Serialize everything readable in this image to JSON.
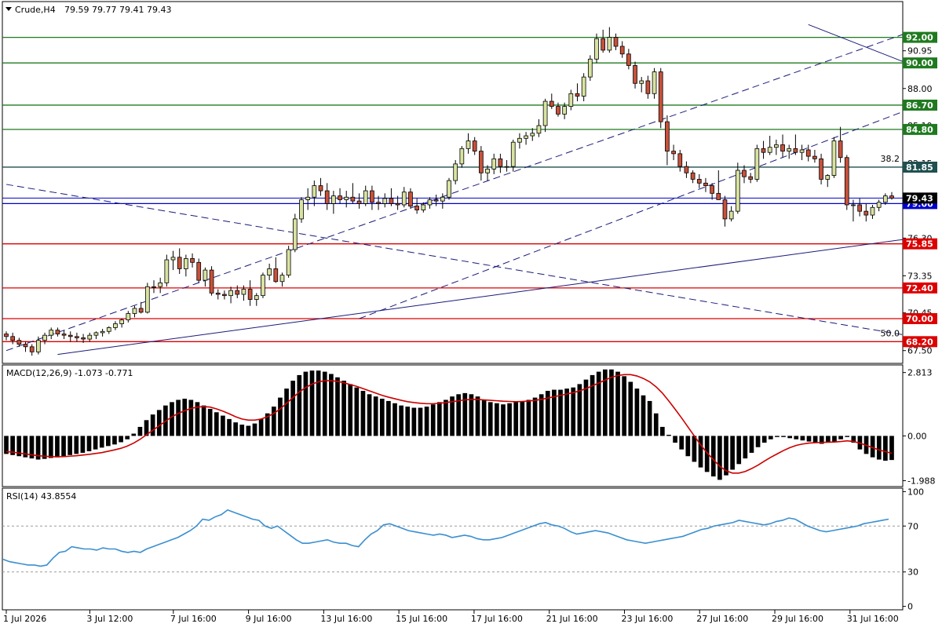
{
  "chart_data": {
    "type": "candlestick",
    "symbol_header": {
      "symbol": "Crude,H4",
      "values": "79.59 79.77 79.41 79.43"
    },
    "price_axis": {
      "range": [
        66.5,
        94.8
      ],
      "ticks": [
        "90.95",
        "88.00",
        "85.10",
        "82.15",
        "79.43",
        "76.30",
        "73.35",
        "70.45",
        "67.50"
      ]
    },
    "horizontal_levels": [
      {
        "value": 92.0,
        "label": "92.00",
        "color": "#1f7a1f"
      },
      {
        "value": 90.0,
        "label": "90.00",
        "color": "#1f7a1f"
      },
      {
        "value": 86.7,
        "label": "86.70",
        "color": "#1f7a1f"
      },
      {
        "value": 84.8,
        "label": "84.80",
        "color": "#1f7a1f"
      },
      {
        "value": 81.85,
        "label": "81.85",
        "color": "#1f4f4f"
      },
      {
        "value": 79.0,
        "label": "79.00",
        "color": "#0000cc"
      },
      {
        "value": 75.85,
        "label": "75.85",
        "color": "#dd0000"
      },
      {
        "value": 72.4,
        "label": "72.40",
        "color": "#dd0000"
      },
      {
        "value": 70.0,
        "label": "70.00",
        "color": "#dd0000"
      },
      {
        "value": 68.2,
        "label": "68.20",
        "color": "#dd0000"
      }
    ],
    "current_price": {
      "value": 79.43,
      "label": "79.43"
    },
    "last_close_line": {
      "value": 79.43,
      "color": "#0000cc"
    },
    "fib_labels": [
      {
        "text": "38.2",
        "value": 82.15
      },
      {
        "text": "50.0",
        "value": 68.5
      }
    ],
    "trend_lines": [
      {
        "style": "dashed",
        "from": [
          0,
          67.5
        ],
        "to": [
          178,
          99.0
        ]
      },
      {
        "style": "dashed",
        "from": [
          55,
          70.0
        ],
        "to": [
          178,
          93.5
        ]
      },
      {
        "style": "dashed",
        "from": [
          0,
          80.5
        ],
        "to": [
          164,
          66.7
        ]
      },
      {
        "style": "solid",
        "from": [
          8,
          67.2
        ],
        "to": [
          178,
          78.8
        ]
      },
      {
        "style": "solid",
        "from": [
          125,
          93.0
        ],
        "to": [
          178,
          82.6
        ]
      }
    ],
    "candles": [
      [
        68.8,
        69.0,
        68.3,
        68.6
      ],
      [
        68.6,
        68.9,
        68.0,
        68.3
      ],
      [
        68.3,
        68.5,
        67.8,
        68.0
      ],
      [
        68.0,
        68.2,
        67.4,
        67.8
      ],
      [
        67.8,
        68.0,
        67.1,
        67.4
      ],
      [
        67.4,
        68.6,
        67.2,
        68.3
      ],
      [
        68.3,
        68.9,
        68.0,
        68.7
      ],
      [
        68.7,
        69.3,
        68.4,
        69.1
      ],
      [
        69.1,
        69.3,
        68.6,
        68.8
      ],
      [
        68.8,
        69.1,
        68.4,
        68.7
      ],
      [
        68.7,
        69.0,
        68.2,
        68.6
      ],
      [
        68.6,
        68.9,
        68.2,
        68.5
      ],
      [
        68.5,
        68.8,
        68.1,
        68.4
      ],
      [
        68.4,
        68.9,
        68.2,
        68.7
      ],
      [
        68.7,
        69.0,
        68.4,
        68.9
      ],
      [
        68.9,
        69.2,
        68.6,
        69.0
      ],
      [
        69.0,
        69.4,
        68.8,
        69.3
      ],
      [
        69.3,
        69.8,
        69.1,
        69.6
      ],
      [
        69.6,
        70.0,
        69.3,
        69.9
      ],
      [
        69.9,
        70.6,
        69.7,
        70.4
      ],
      [
        70.4,
        71.0,
        70.1,
        70.8
      ],
      [
        70.8,
        71.3,
        70.4,
        70.5
      ],
      [
        70.5,
        72.8,
        70.4,
        72.5
      ],
      [
        72.5,
        73.0,
        72.0,
        72.5
      ],
      [
        72.5,
        73.2,
        72.0,
        72.8
      ],
      [
        72.8,
        75.0,
        72.5,
        74.6
      ],
      [
        74.6,
        75.3,
        73.8,
        74.8
      ],
      [
        74.8,
        75.5,
        73.5,
        73.9
      ],
      [
        73.9,
        75.0,
        73.3,
        74.7
      ],
      [
        74.7,
        75.1,
        74.0,
        74.4
      ],
      [
        74.4,
        74.7,
        72.8,
        73.0
      ],
      [
        73.0,
        74.0,
        72.5,
        73.8
      ],
      [
        73.8,
        74.1,
        71.8,
        72.0
      ],
      [
        72.0,
        72.3,
        71.5,
        71.9
      ],
      [
        71.9,
        72.2,
        71.5,
        71.8
      ],
      [
        71.8,
        72.5,
        71.2,
        72.2
      ],
      [
        72.2,
        72.6,
        71.6,
        71.9
      ],
      [
        71.9,
        72.6,
        71.4,
        72.3
      ],
      [
        72.3,
        73.0,
        71.0,
        71.5
      ],
      [
        71.5,
        72.0,
        71.0,
        71.8
      ],
      [
        71.8,
        73.6,
        71.6,
        73.4
      ],
      [
        73.4,
        74.3,
        73.0,
        73.9
      ],
      [
        73.9,
        74.8,
        72.8,
        72.9
      ],
      [
        72.9,
        73.6,
        72.5,
        73.4
      ],
      [
        73.4,
        75.7,
        73.2,
        75.4
      ],
      [
        75.4,
        78.2,
        75.2,
        77.8
      ],
      [
        77.8,
        79.5,
        77.5,
        79.3
      ],
      [
        79.3,
        80.2,
        78.5,
        79.5
      ],
      [
        79.5,
        80.8,
        78.8,
        80.4
      ],
      [
        80.4,
        81.0,
        79.6,
        80.0
      ],
      [
        80.0,
        80.6,
        78.5,
        79.0
      ],
      [
        79.0,
        80.0,
        78.2,
        79.6
      ],
      [
        79.6,
        80.2,
        79.0,
        79.3
      ],
      [
        79.3,
        80.0,
        78.7,
        79.5
      ],
      [
        79.5,
        80.6,
        79.0,
        79.2
      ],
      [
        79.2,
        79.8,
        78.6,
        79.0
      ],
      [
        79.0,
        80.4,
        78.8,
        80.0
      ],
      [
        80.0,
        80.4,
        78.5,
        79.1
      ],
      [
        79.1,
        79.6,
        78.5,
        79.0
      ],
      [
        79.0,
        79.8,
        78.7,
        79.4
      ],
      [
        79.4,
        80.2,
        78.8,
        79.0
      ],
      [
        79.0,
        79.6,
        78.5,
        78.9
      ],
      [
        78.9,
        80.3,
        78.7,
        79.9
      ],
      [
        79.9,
        80.2,
        78.6,
        78.8
      ],
      [
        78.8,
        79.4,
        78.2,
        78.5
      ],
      [
        78.5,
        79.1,
        78.3,
        78.9
      ],
      [
        78.9,
        79.5,
        78.6,
        79.3
      ],
      [
        79.3,
        79.7,
        78.8,
        79.2
      ],
      [
        79.2,
        79.8,
        78.6,
        79.5
      ],
      [
        79.5,
        81.0,
        79.3,
        80.8
      ],
      [
        80.8,
        82.4,
        80.5,
        82.1
      ],
      [
        82.1,
        83.5,
        81.8,
        83.3
      ],
      [
        83.3,
        84.5,
        82.9,
        83.9
      ],
      [
        83.9,
        84.2,
        82.8,
        83.1
      ],
      [
        83.1,
        83.5,
        80.8,
        81.4
      ],
      [
        81.4,
        82.0,
        80.8,
        81.7
      ],
      [
        81.7,
        82.9,
        81.3,
        82.5
      ],
      [
        82.5,
        82.9,
        81.4,
        81.9
      ],
      [
        81.9,
        82.4,
        81.5,
        81.9
      ],
      [
        81.9,
        84.0,
        81.5,
        83.8
      ],
      [
        83.8,
        84.5,
        83.3,
        84.1
      ],
      [
        84.1,
        84.6,
        83.6,
        84.3
      ],
      [
        84.3,
        84.9,
        83.9,
        84.5
      ],
      [
        84.5,
        85.6,
        84.2,
        85.1
      ],
      [
        85.1,
        87.2,
        84.6,
        87.0
      ],
      [
        87.0,
        87.6,
        86.4,
        86.6
      ],
      [
        86.6,
        86.9,
        85.8,
        86.0
      ],
      [
        86.0,
        86.9,
        85.6,
        86.6
      ],
      [
        86.6,
        87.9,
        86.3,
        87.6
      ],
      [
        87.6,
        88.4,
        87.0,
        87.4
      ],
      [
        87.4,
        89.2,
        87.0,
        88.9
      ],
      [
        88.9,
        90.6,
        88.6,
        90.3
      ],
      [
        90.3,
        92.3,
        90.0,
        91.9
      ],
      [
        91.9,
        92.6,
        90.8,
        91.0
      ],
      [
        91.0,
        92.8,
        90.8,
        92.0
      ],
      [
        92.0,
        92.3,
        91.0,
        91.3
      ],
      [
        91.3,
        91.7,
        90.4,
        90.7
      ],
      [
        90.7,
        91.1,
        89.5,
        89.8
      ],
      [
        89.8,
        90.1,
        88.0,
        88.4
      ],
      [
        88.4,
        88.9,
        87.7,
        88.6
      ],
      [
        88.6,
        89.0,
        87.2,
        87.6
      ],
      [
        87.6,
        89.6,
        87.2,
        89.3
      ],
      [
        89.3,
        89.6,
        84.9,
        85.4
      ],
      [
        85.4,
        85.9,
        82.0,
        83.1
      ],
      [
        83.1,
        83.6,
        82.4,
        82.9
      ],
      [
        82.9,
        83.2,
        81.5,
        81.9
      ],
      [
        81.9,
        82.3,
        81.0,
        81.4
      ],
      [
        81.4,
        81.6,
        80.6,
        80.9
      ],
      [
        80.9,
        81.3,
        80.2,
        80.6
      ],
      [
        80.6,
        81.0,
        79.9,
        80.4
      ],
      [
        80.4,
        80.6,
        79.3,
        79.8
      ],
      [
        79.8,
        81.6,
        79.4,
        79.3
      ],
      [
        79.3,
        79.6,
        77.2,
        77.8
      ],
      [
        77.8,
        78.8,
        77.6,
        78.4
      ],
      [
        78.4,
        82.2,
        78.2,
        81.6
      ],
      [
        81.6,
        82.0,
        80.6,
        81.1
      ],
      [
        81.1,
        81.4,
        80.6,
        80.9
      ],
      [
        80.9,
        83.6,
        80.7,
        83.3
      ],
      [
        83.3,
        83.9,
        82.5,
        83.0
      ],
      [
        83.0,
        84.3,
        82.8,
        83.4
      ],
      [
        83.4,
        84.0,
        82.8,
        83.6
      ],
      [
        83.6,
        84.4,
        82.6,
        83.1
      ],
      [
        83.1,
        83.6,
        82.5,
        83.3
      ],
      [
        83.3,
        84.4,
        82.8,
        83.0
      ],
      [
        83.0,
        83.6,
        82.4,
        83.2
      ],
      [
        83.2,
        83.6,
        82.3,
        82.7
      ],
      [
        82.7,
        83.2,
        82.2,
        82.5
      ],
      [
        82.5,
        82.9,
        80.5,
        80.9
      ],
      [
        80.9,
        81.3,
        80.3,
        81.2
      ],
      [
        81.2,
        84.2,
        81.0,
        83.9
      ],
      [
        83.9,
        85.0,
        82.2,
        82.6
      ],
      [
        82.6,
        82.8,
        78.5,
        78.9
      ],
      [
        78.9,
        79.3,
        77.6,
        78.9
      ],
      [
        78.9,
        79.4,
        78.0,
        78.4
      ],
      [
        78.4,
        79.0,
        77.6,
        78.1
      ],
      [
        78.1,
        78.9,
        77.8,
        78.7
      ],
      [
        78.7,
        79.3,
        78.4,
        79.1
      ],
      [
        79.1,
        79.8,
        78.9,
        79.6
      ],
      [
        79.6,
        79.9,
        79.3,
        79.43
      ]
    ],
    "macd": {
      "label": "MACD(12,26,9) -1.073 -0.771",
      "range": [
        -2.25,
        3.15
      ],
      "ticks": [
        "2.813",
        "0.00",
        "-1.988"
      ],
      "histogram": [
        -0.8,
        -0.85,
        -0.9,
        -0.95,
        -1.0,
        -1.05,
        -1.02,
        -0.98,
        -0.95,
        -0.9,
        -0.85,
        -0.8,
        -0.75,
        -0.68,
        -0.6,
        -0.52,
        -0.45,
        -0.38,
        -0.28,
        -0.15,
        0.1,
        0.4,
        0.7,
        0.95,
        1.15,
        1.35,
        1.5,
        1.6,
        1.65,
        1.6,
        1.5,
        1.35,
        1.2,
        1.05,
        0.9,
        0.75,
        0.6,
        0.5,
        0.45,
        0.55,
        0.75,
        1.0,
        1.3,
        1.7,
        2.1,
        2.45,
        2.7,
        2.85,
        2.9,
        2.9,
        2.85,
        2.75,
        2.6,
        2.45,
        2.3,
        2.15,
        2.0,
        1.85,
        1.75,
        1.65,
        1.55,
        1.45,
        1.35,
        1.3,
        1.25,
        1.25,
        1.3,
        1.4,
        1.5,
        1.6,
        1.75,
        1.85,
        1.9,
        1.85,
        1.75,
        1.6,
        1.5,
        1.45,
        1.4,
        1.45,
        1.5,
        1.55,
        1.6,
        1.7,
        1.85,
        2.0,
        2.05,
        2.05,
        2.1,
        2.15,
        2.3,
        2.5,
        2.7,
        2.85,
        2.95,
        2.95,
        2.85,
        2.65,
        2.4,
        2.1,
        1.8,
        1.55,
        1.0,
        0.4,
        0.05,
        -0.3,
        -0.6,
        -0.9,
        -1.15,
        -1.4,
        -1.6,
        -1.8,
        -1.95,
        -1.75,
        -1.5,
        -1.25,
        -1.0,
        -0.75,
        -0.5,
        -0.3,
        -0.15,
        -0.05,
        -0.05,
        -0.1,
        -0.15,
        -0.2,
        -0.25,
        -0.3,
        -0.35,
        -0.3,
        -0.25,
        -0.15,
        -0.05,
        -0.3,
        -0.6,
        -0.8,
        -0.95,
        -1.05,
        -1.1,
        -1.07
      ],
      "signal": [
        -0.7,
        -0.72,
        -0.76,
        -0.8,
        -0.84,
        -0.88,
        -0.9,
        -0.92,
        -0.93,
        -0.92,
        -0.9,
        -0.88,
        -0.85,
        -0.82,
        -0.78,
        -0.74,
        -0.68,
        -0.62,
        -0.55,
        -0.45,
        -0.32,
        -0.15,
        0.05,
        0.25,
        0.45,
        0.65,
        0.85,
        1.0,
        1.12,
        1.22,
        1.28,
        1.3,
        1.28,
        1.2,
        1.1,
        0.98,
        0.85,
        0.75,
        0.7,
        0.7,
        0.75,
        0.85,
        1.0,
        1.2,
        1.45,
        1.7,
        1.95,
        2.15,
        2.3,
        2.4,
        2.45,
        2.45,
        2.42,
        2.36,
        2.28,
        2.2,
        2.1,
        2.0,
        1.9,
        1.8,
        1.72,
        1.65,
        1.58,
        1.52,
        1.48,
        1.45,
        1.43,
        1.43,
        1.45,
        1.48,
        1.52,
        1.56,
        1.6,
        1.62,
        1.62,
        1.6,
        1.58,
        1.56,
        1.54,
        1.53,
        1.52,
        1.53,
        1.55,
        1.58,
        1.62,
        1.68,
        1.74,
        1.8,
        1.86,
        1.92,
        2.0,
        2.1,
        2.22,
        2.35,
        2.48,
        2.6,
        2.68,
        2.72,
        2.72,
        2.66,
        2.55,
        2.4,
        2.18,
        1.9,
        1.55,
        1.18,
        0.8,
        0.4,
        0.0,
        -0.4,
        -0.75,
        -1.05,
        -1.35,
        -1.55,
        -1.65,
        -1.65,
        -1.58,
        -1.45,
        -1.3,
        -1.12,
        -0.95,
        -0.8,
        -0.65,
        -0.52,
        -0.42,
        -0.36,
        -0.32,
        -0.3,
        -0.29,
        -0.28,
        -0.27,
        -0.25,
        -0.22,
        -0.25,
        -0.32,
        -0.42,
        -0.52,
        -0.62,
        -0.7,
        -0.77
      ]
    },
    "rsi": {
      "label": "RSI(14) 43.8554",
      "range": [
        -3,
        103
      ],
      "ticks": [
        "100",
        "70",
        "30",
        "0"
      ],
      "levels": [
        70,
        30
      ],
      "values": [
        41,
        39,
        38,
        37,
        36,
        36,
        35,
        36,
        42,
        47,
        48,
        52,
        51,
        50,
        50,
        49,
        51,
        50,
        50,
        48,
        47,
        48,
        47,
        50,
        52,
        54,
        56,
        58,
        60,
        63,
        66,
        70,
        76,
        75,
        78,
        80,
        84,
        82,
        80,
        78,
        76,
        75,
        70,
        68,
        70,
        66,
        62,
        58,
        55,
        55,
        56,
        57,
        58,
        56,
        55,
        55,
        53,
        52,
        58,
        63,
        66,
        71,
        72,
        70,
        68,
        66,
        65,
        64,
        63,
        62,
        63,
        62,
        60,
        61,
        62,
        61,
        59,
        58,
        58,
        59,
        60,
        62,
        64,
        66,
        68,
        70,
        72,
        73,
        71,
        70,
        68,
        65,
        63,
        64,
        65,
        66,
        65,
        64,
        62,
        60,
        58,
        57,
        56,
        55,
        56,
        57,
        58,
        59,
        60,
        61,
        63,
        65,
        67,
        68,
        70,
        71,
        72,
        73,
        75,
        74,
        73,
        72,
        71,
        72,
        74,
        75,
        77,
        76,
        73,
        70,
        68,
        66,
        65,
        66,
        67,
        68,
        69,
        70,
        72,
        73,
        74,
        75,
        76
      ]
    },
    "time_axis": [
      {
        "i": 0,
        "label": "1 Jul 2026"
      },
      {
        "i": 20,
        "label": "3 Jul 12:00"
      },
      {
        "i": 40,
        "label": "7 Jul 16:00"
      },
      {
        "i": 58,
        "label": "9 Jul 16:00"
      },
      {
        "i": 76,
        "label": "13 Jul 16:00"
      },
      {
        "i": 94,
        "label": "15 Jul 16:00"
      },
      {
        "i": 112,
        "label": "17 Jul 16:00"
      },
      {
        "i": 130,
        "label": "21 Jul 16:00"
      },
      {
        "i": 148,
        "label": "23 Jul 16:00"
      },
      {
        "i": 166,
        "label": "27 Jul 16:00"
      },
      {
        "i": 184,
        "label": "29 Jul 16:00"
      },
      {
        "i": 202,
        "label": "31 Jul 16:00"
      }
    ],
    "colors": {
      "bull": "#d9e3a1",
      "bear": "#c8513a",
      "macd_hist": "#000000",
      "macd_signal": "#cc0000",
      "rsi_line": "#3a8fd0",
      "grid_border": "#000000"
    }
  }
}
